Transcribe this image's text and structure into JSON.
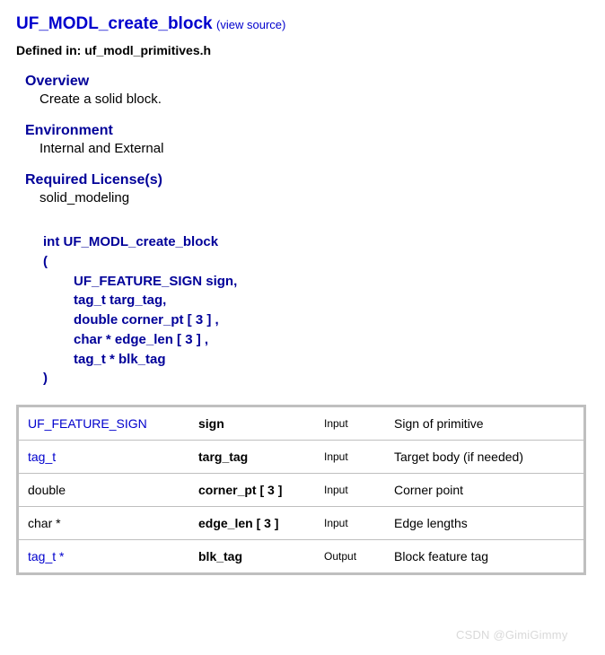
{
  "title": {
    "name": "UF_MODL_create_block",
    "view_source": "(view source)"
  },
  "defined_in": {
    "label": "Defined in:",
    "file": "uf_modl_primitives.h"
  },
  "sections": [
    {
      "head": "Overview",
      "body": "Create a solid block."
    },
    {
      "head": "Environment",
      "body": "Internal and External"
    },
    {
      "head": "Required License(s)",
      "body": "solid_modeling"
    }
  ],
  "signature": {
    "ret_and_name": "int UF_MODL_create_block",
    "open": "(",
    "params": [
      "UF_FEATURE_SIGN sign,",
      "tag_t targ_tag,",
      "double corner_pt [ 3 ] ,",
      "char * edge_len [ 3 ] ,",
      "tag_t * blk_tag"
    ],
    "close": ")"
  },
  "table": [
    {
      "type": "UF_FEATURE_SIGN",
      "is_link": true,
      "name": "sign",
      "dir": "Input",
      "desc": "Sign of primitive"
    },
    {
      "type": "tag_t",
      "is_link": true,
      "name": "targ_tag",
      "dir": "Input",
      "desc": "Target body (if needed)"
    },
    {
      "type": "double",
      "is_link": false,
      "name": "corner_pt [ 3 ]",
      "dir": "Input",
      "desc": "Corner point"
    },
    {
      "type": "char *",
      "is_link": false,
      "name": "edge_len [ 3 ]",
      "dir": "Input",
      "desc": "Edge lengths"
    },
    {
      "type": "tag_t *",
      "is_link": true,
      "name": "blk_tag",
      "dir": "Output",
      "desc": "Block feature tag"
    }
  ],
  "watermark": "CSDN @GimiGimmy"
}
